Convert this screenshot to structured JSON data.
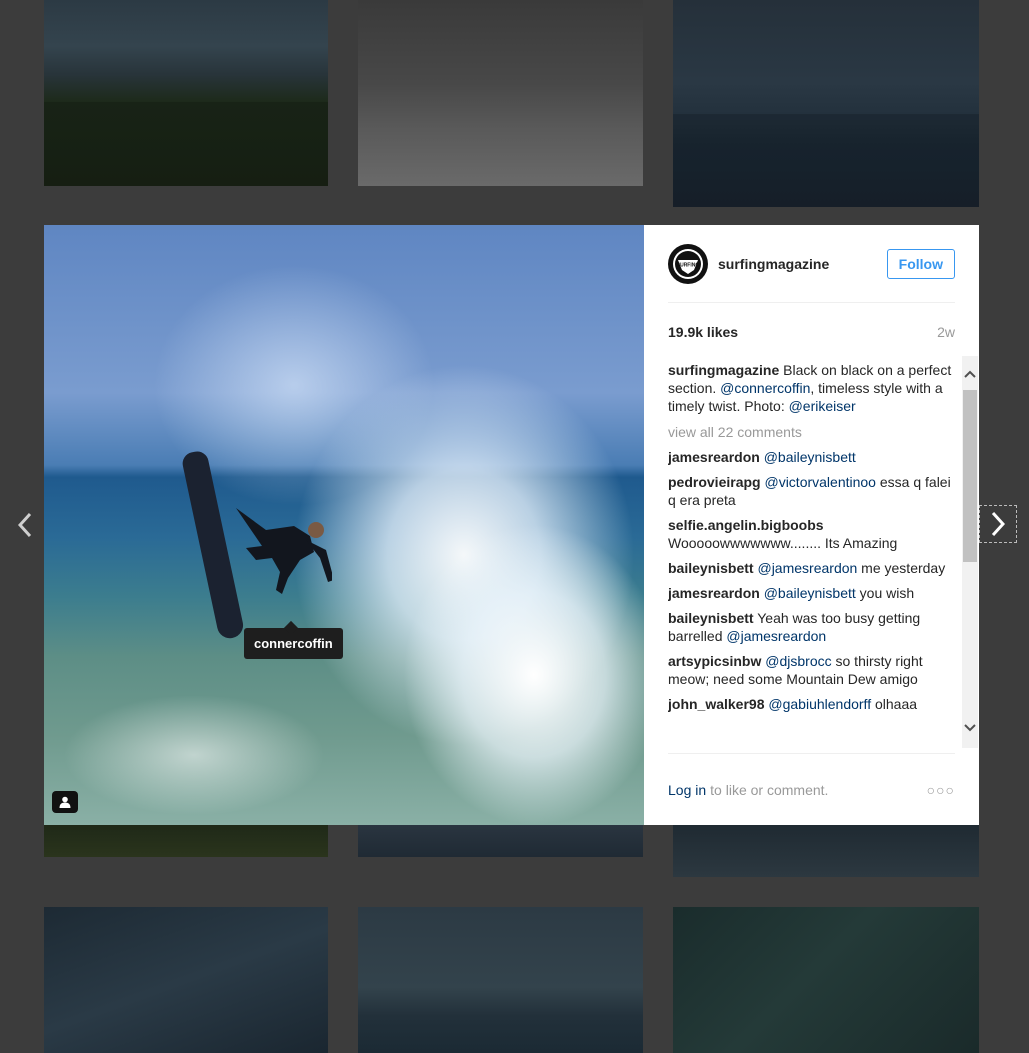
{
  "post": {
    "username": "surfingmagazine",
    "follow_label": "Follow",
    "likes": "19.9k likes",
    "age": "2w",
    "caption": {
      "username": "surfingmagazine",
      "text1": " Black on black on a perfect section. ",
      "mention1": "@connercoffin",
      "text2": ", timeless style with a timely twist. Photo: ",
      "mention2": "@erikeiser"
    },
    "view_all": "view all 22 comments",
    "photo_tag": "connercoffin",
    "avatar_text": "SURFING"
  },
  "comments": [
    {
      "user": "jamesreardon",
      "mention": "@baileynisbett",
      "text": ""
    },
    {
      "user": "pedrovieirapg",
      "mention": "@victorvalentinoo",
      "text": " essa q falei q era preta"
    },
    {
      "user": "selfie.angelin.bigboobs",
      "mention": "",
      "text": " Wooooowwwwwww........ Its Amazing"
    },
    {
      "user": "baileynisbett",
      "mention": "@jamesreardon",
      "text": " me yesterday"
    },
    {
      "user": "jamesreardon",
      "mention": "@baileynisbett",
      "text": " you wish"
    },
    {
      "user": "baileynisbett",
      "mention": "",
      "text": " Yeah was too busy getting barrelled "
    },
    {
      "user": "artsypicsinbw",
      "mention": "@djsbrocc",
      "text": " so thirsty right meow; need some Mountain Dew amigo"
    },
    {
      "user": "john_walker98",
      "mention": "@gabiuhlendorff",
      "text": " olhaaa"
    }
  ],
  "comment6_trailing_mention": "@jamesreardon",
  "footer": {
    "login_link": "Log in",
    "login_text": "to like or comment.",
    "more": "○○○"
  },
  "icons": {
    "prev": "chevron-left-icon",
    "next": "chevron-right-icon",
    "user_tag": "user-icon"
  }
}
